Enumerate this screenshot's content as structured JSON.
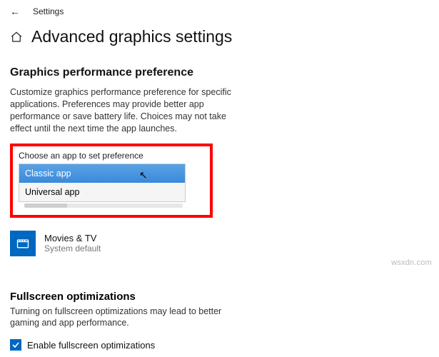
{
  "top": {
    "back_aria": "Back",
    "app_label": "Settings"
  },
  "header": {
    "title": "Advanced graphics settings"
  },
  "perf": {
    "heading": "Graphics performance preference",
    "description": "Customize graphics performance preference for specific applications. Preferences may provide better app performance or save battery life. Choices may not take effect until the next time the app launches.",
    "choose_label": "Choose an app to set preference",
    "options": {
      "classic": "Classic app",
      "universal": "Universal app"
    },
    "app_item": {
      "name": "Movies & TV",
      "sub": "System default"
    }
  },
  "fullscreen": {
    "heading": "Fullscreen optimizations",
    "description": "Turning on fullscreen optimizations may lead to better gaming and app performance.",
    "checkbox_label": "Enable fullscreen optimizations",
    "checked": true
  },
  "watermark": "wsxdn.com"
}
